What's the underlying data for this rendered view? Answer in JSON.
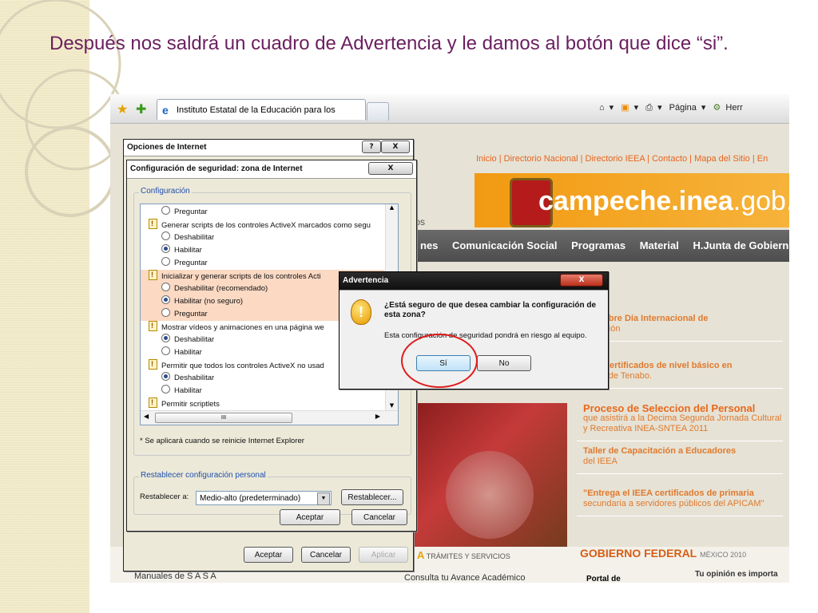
{
  "slide": {
    "title": "Después nos saldrá un cuadro de Advertencia y le damos al botón que dice “si”."
  },
  "browser": {
    "tab_title": "Instituto Estatal de la Educación para los Adultos",
    "toolbar_right": {
      "home": "▾",
      "feeds": "▾",
      "print": "▾",
      "page": "Página",
      "tools": "Herr"
    }
  },
  "website": {
    "top_links": "Inicio | Directorio Nacional | Directorio IEEA | Contacto | Mapa del Sitio | En",
    "brand_bold": "campeche.inea",
    "brand_rest": ".gob.mx",
    "tos": "tos",
    "nav": [
      "nes",
      "Comunicación Social",
      "Programas",
      "Material",
      "H.Junta de Gobierno"
    ],
    "news": [
      {
        "title": "iatiembre Día Internacional de",
        "desc": "fetización"
      },
      {
        "title": "a de Certificados de nivel básico en",
        "desc": "ncipio de Tenabo."
      },
      {
        "title": "Proceso de Seleccion del Personal",
        "desc": "que asistirá a la Decima Segunda Jornada Cultural y Recreativa INEA-SNTEA 2011"
      },
      {
        "title": "Taller de Capacitación a Educadores",
        "desc": "del IEEA"
      },
      {
        "title": "\"Entrega el IEEA certificados de primaria",
        "desc": "secundaria a servidores públicos del APICAM\""
      }
    ],
    "tramites_letter": "A",
    "tramites": "TRÁMITES Y SERVICIOS",
    "gobierno": "GOBIERNO FEDERAL",
    "gobierno_sub": "MÉXICO 2010",
    "consulta": "Consulta tu Avance Académico",
    "manuales": "Manuales de S A S A",
    "opinion": "Tu opinión es importa",
    "portal": "Portal de"
  },
  "internet_options": {
    "title": "Opciones de Internet",
    "help": "?",
    "close": "X",
    "ok": "Aceptar",
    "cancel": "Cancelar",
    "apply": "Aplicar"
  },
  "security_settings": {
    "title": "Configuración de seguridad: zona de Internet",
    "close": "X",
    "group_label": "Configuración",
    "rows": [
      {
        "type": "radio",
        "checked": false,
        "label": "Preguntar"
      },
      {
        "type": "header",
        "label": "Generar scripts de los controles ActiveX marcados como segu"
      },
      {
        "type": "radio",
        "checked": false,
        "label": "Deshabilitar"
      },
      {
        "type": "radio",
        "checked": true,
        "label": "Habilitar"
      },
      {
        "type": "radio",
        "checked": false,
        "label": "Preguntar"
      },
      {
        "type": "header",
        "label": "Inicializar y generar scripts de los controles Acti",
        "hl": true
      },
      {
        "type": "radio",
        "checked": false,
        "label": "Deshabilitar (recomendado)",
        "hl": true
      },
      {
        "type": "radio",
        "checked": true,
        "label": "Habilitar (no seguro)",
        "hl": true
      },
      {
        "type": "radio",
        "checked": false,
        "label": "Preguntar",
        "hl": true
      },
      {
        "type": "header",
        "label": "Mostrar vídeos y animaciones en una página we"
      },
      {
        "type": "radio",
        "checked": true,
        "label": "Deshabilitar"
      },
      {
        "type": "radio",
        "checked": false,
        "label": "Habilitar"
      },
      {
        "type": "header",
        "label": "Permitir que todos los controles ActiveX no usad"
      },
      {
        "type": "radio",
        "checked": true,
        "label": "Deshabilitar"
      },
      {
        "type": "radio",
        "checked": false,
        "label": "Habilitar"
      },
      {
        "type": "header",
        "label": "Permitir scriptlets"
      }
    ],
    "scroll_mark": "III",
    "note": "* Se aplicará cuando se reinicie Internet Explorer",
    "reset_group_label": "Restablecer configuración personal",
    "reset_label": "Restablecer a:",
    "reset_value": "Medio-alto (predeterminado)",
    "reset_button": "Restablecer...",
    "ok": "Aceptar",
    "cancel": "Cancelar"
  },
  "warning": {
    "title": "Advertencia",
    "close": "X",
    "question": "¿Está seguro de que desea cambiar la configuración de esta zona?",
    "detail": "Esta configuración de seguridad pondrá en riesgo al equipo.",
    "yes": "Sí",
    "no": "No"
  },
  "colors": {
    "title": "#6b1f5f",
    "highlight": "#e01b1b",
    "web_orange": "#f29a12"
  }
}
